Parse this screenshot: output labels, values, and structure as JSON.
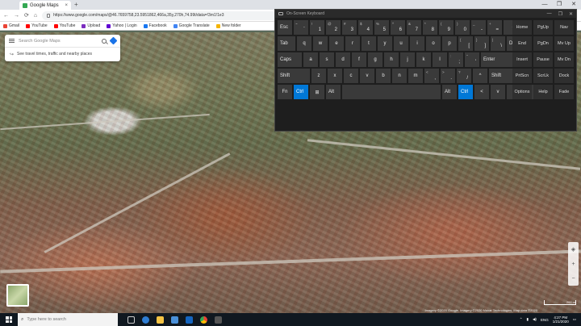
{
  "browser": {
    "tab_title": "Google Maps",
    "tab_close": "×",
    "new_tab": "+",
    "window_controls": [
      "—",
      "❐",
      "✕"
    ],
    "nav": [
      "←",
      "→",
      "⟳",
      "⌂"
    ],
    "url": "https://www.google.com/maps/@46.7659758,23.5951862,466a,35y,270h,74.99t/data=!3m1!1e3",
    "bookmarks": [
      {
        "label": "Gmail",
        "color": "#ea4335"
      },
      {
        "label": "YouTube",
        "color": "#ff0000"
      },
      {
        "label": "YouTube",
        "color": "#ff0000"
      },
      {
        "label": "Upload",
        "color": "#7b2cbf"
      },
      {
        "label": "Yahoo | Login",
        "color": "#6001d2"
      },
      {
        "label": "Facebook",
        "color": "#1877f2"
      },
      {
        "label": "Google Translate",
        "color": "#4285f4"
      },
      {
        "label": "New folder",
        "color": "#f4b400"
      }
    ]
  },
  "maps": {
    "search_placeholder": "Search Google Maps",
    "traffic_text": "See travel times, traffic and nearby places",
    "attribution": "Imagery ©2020 Google, Imagery ©2020 Maxar Technologies, Map data ©2020",
    "scale": "200 m"
  },
  "keyboard": {
    "title": "On-Screen Keyboard",
    "controls": [
      "—",
      "❐",
      "✕"
    ],
    "accent": "#0078d7"
  },
  "taskbar": {
    "search_placeholder": "Type here to search",
    "time": "4:27 PM",
    "date": "1/21/2020",
    "lang": "ENG"
  }
}
